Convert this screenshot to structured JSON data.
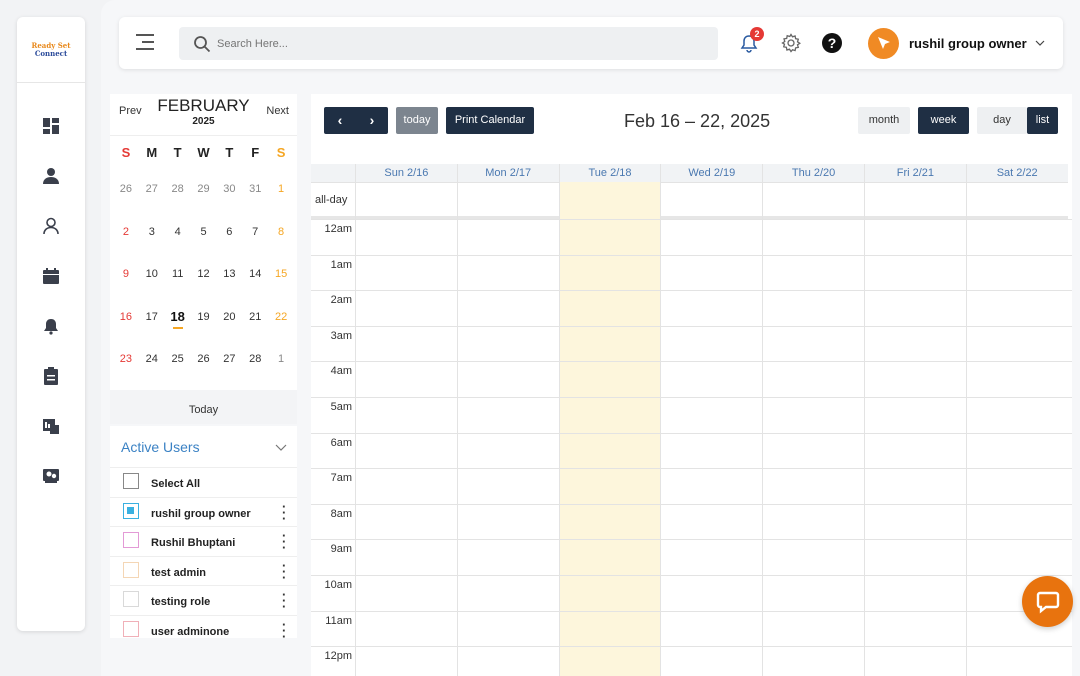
{
  "brand": {
    "logo_line1": "Ready Set",
    "logo_line2": "Connect"
  },
  "sidebar": {
    "icons": [
      "dashboard-icon",
      "user-group-icon",
      "user-icon",
      "calendar-icon",
      "alarm-bell-icon",
      "clipboard-icon",
      "report-icon",
      "team-icon"
    ]
  },
  "header": {
    "search_placeholder": "Search Here...",
    "notification_count": "2",
    "help": "?",
    "user_name": "rushil group owner"
  },
  "minical": {
    "prev": "Prev",
    "next": "Next",
    "month": "FEBRUARY",
    "year": "2025",
    "dows": [
      "S",
      "M",
      "T",
      "W",
      "T",
      "F",
      "S"
    ],
    "weeks": [
      [
        "26",
        "27",
        "28",
        "29",
        "30",
        "31",
        "1"
      ],
      [
        "2",
        "3",
        "4",
        "5",
        "6",
        "7",
        "8"
      ],
      [
        "9",
        "10",
        "11",
        "12",
        "13",
        "14",
        "15"
      ],
      [
        "16",
        "17",
        "18",
        "19",
        "20",
        "21",
        "22"
      ],
      [
        "23",
        "24",
        "25",
        "26",
        "27",
        "28",
        "1"
      ]
    ],
    "today": "18",
    "today_label": "Today"
  },
  "active_users": {
    "title": "Active Users",
    "select_all": "Select All",
    "users": [
      {
        "name": "rushil group owner",
        "color": "#3ab0e0",
        "checked": true
      },
      {
        "name": "Rushil Bhuptani",
        "color": "#e39ad6",
        "checked": false
      },
      {
        "name": "test admin",
        "color": "#f4d6b5",
        "checked": false
      },
      {
        "name": "testing role",
        "color": "#d9d9d9",
        "checked": false
      },
      {
        "name": "user adminone",
        "color": "#f0b0b8",
        "checked": false
      }
    ]
  },
  "toolbar": {
    "prev": "‹",
    "next": "›",
    "today": "today",
    "print": "Print Calendar",
    "range": "Feb 16 – 22, 2025",
    "month": "month",
    "week": "week",
    "day": "day",
    "list": "list",
    "active_view": "week"
  },
  "week": {
    "days": [
      "Sun 2/16",
      "Mon 2/17",
      "Tue 2/18",
      "Wed 2/19",
      "Thu 2/20",
      "Fri 2/21",
      "Sat 2/22"
    ],
    "today_index": 2,
    "allday_label": "all-day",
    "hours": [
      "12am",
      "1am",
      "2am",
      "3am",
      "4am",
      "5am",
      "6am",
      "7am",
      "8am",
      "9am",
      "10am",
      "11am",
      "12pm"
    ]
  }
}
